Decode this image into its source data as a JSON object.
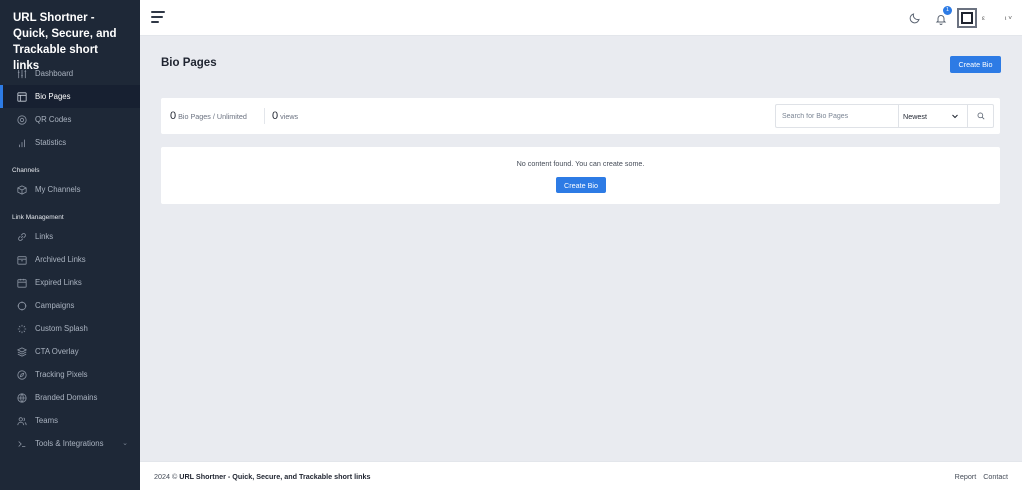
{
  "brand": {
    "title": "URL Shortner - Quick, Secure, and Trackable short links"
  },
  "sidebar": {
    "items": [
      {
        "label": "Dashboard",
        "icon": "dashboard-icon",
        "active": false
      },
      {
        "label": "Bio Pages",
        "icon": "layout-icon",
        "active": true
      },
      {
        "label": "QR Codes",
        "icon": "qr-icon",
        "active": false
      },
      {
        "label": "Statistics",
        "icon": "bar-chart-icon",
        "active": false
      }
    ],
    "section_channels": "Channels",
    "channels": [
      {
        "label": "My Channels",
        "icon": "box-icon"
      }
    ],
    "section_links": "Link Management",
    "links": [
      {
        "label": "Links",
        "icon": "link-icon"
      },
      {
        "label": "Archived Links",
        "icon": "archive-icon"
      },
      {
        "label": "Expired Links",
        "icon": "calendar-icon"
      },
      {
        "label": "Campaigns",
        "icon": "target-icon"
      },
      {
        "label": "Custom Splash",
        "icon": "loader-icon"
      },
      {
        "label": "CTA Overlay",
        "icon": "layers-icon"
      },
      {
        "label": "Tracking Pixels",
        "icon": "compass-icon"
      },
      {
        "label": "Branded Domains",
        "icon": "globe-icon"
      },
      {
        "label": "Teams",
        "icon": "users-icon"
      },
      {
        "label": "Tools & Integrations",
        "icon": "terminal-icon"
      }
    ]
  },
  "topbar": {
    "notification_count": "1",
    "avatar_label": "ε",
    "user_menu": "ι ˅"
  },
  "main": {
    "title": "Bio Pages",
    "create_button": "Create Bio",
    "stats": {
      "bio_count": "0",
      "bio_label": "Bio Pages / Unlimited",
      "views_count": "0",
      "views_label": "views"
    },
    "search": {
      "placeholder": "Search for Bio Pages"
    },
    "sort": {
      "selected": "Newest"
    },
    "empty": {
      "message": "No content found. You can create some.",
      "button": "Create Bio"
    }
  },
  "footer": {
    "year": "2024 ©",
    "site": "URL Shortner - Quick, Secure, and Trackable short links",
    "links": [
      "Report",
      "Contact"
    ]
  },
  "colors": {
    "accent": "#2d7be5",
    "sidebar_bg": "#1e2837",
    "page_bg": "#e9ebf0"
  }
}
